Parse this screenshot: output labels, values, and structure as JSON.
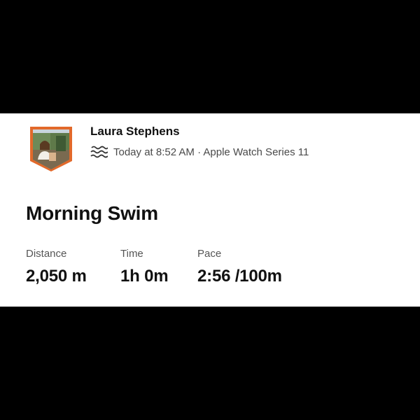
{
  "athlete": {
    "name": "Laura Stephens",
    "avatar_icon": "athlete-avatar-badge",
    "badge_color": "#e2692a"
  },
  "activity": {
    "sport_icon": "swim-waves-icon",
    "meta": "Today at 8:52 AM · Apple Watch Series 11",
    "title": "Morning Swim"
  },
  "stats": [
    {
      "label": "Distance",
      "value": "2,050 m"
    },
    {
      "label": "Time",
      "value": "1h 0m"
    },
    {
      "label": "Pace",
      "value": "2:56 /100m"
    }
  ]
}
